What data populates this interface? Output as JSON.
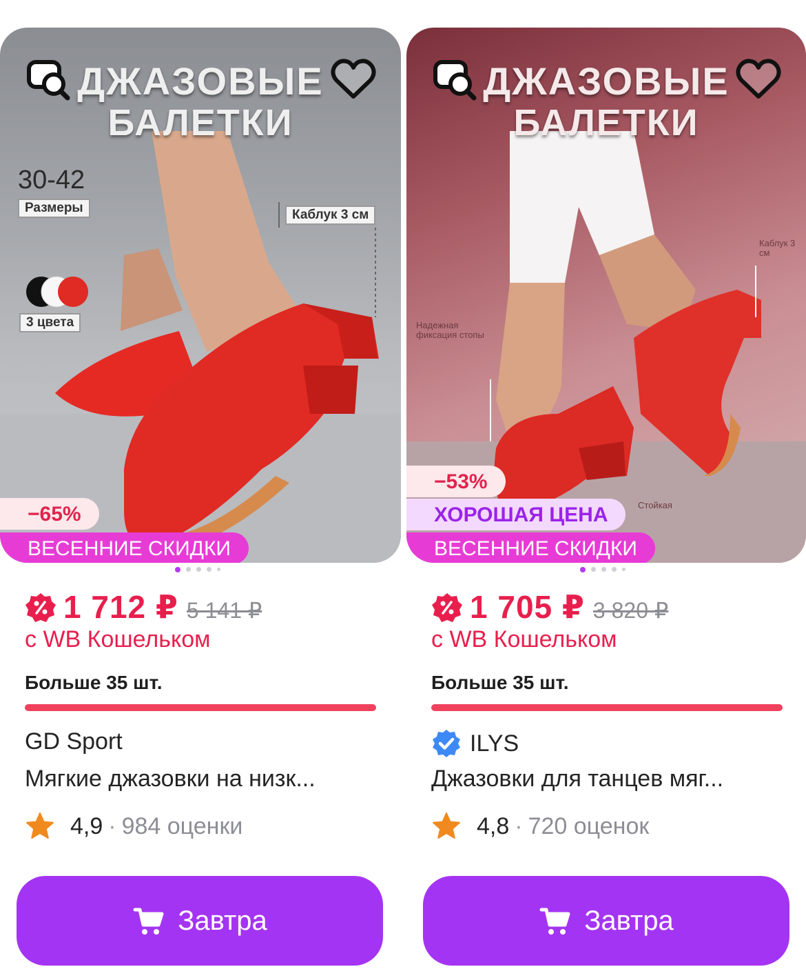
{
  "cards": [
    {
      "photo_title": [
        "ДЖАЗОВЫЕ",
        "БАЛЕТКИ"
      ],
      "photo_specs": {
        "sizes": "30-42",
        "sizes_label": "Размеры",
        "heel": "Каблук 3 см",
        "colors_label": "3 цвета"
      },
      "discount": "−65%",
      "badge_good": "",
      "sale_label": "ВЕСЕННИЕ СКИДКИ",
      "price": "1 712 ₽",
      "old_price": "5 141 ₽",
      "wallet": "с WB Кошельком",
      "stock": "Больше 35 шт.",
      "brand": "GD Sport",
      "verified": false,
      "description": "Мягкие джазовки на низк...",
      "rating": "4,9",
      "separator": "·",
      "reviews": "984 оценки",
      "button": "Завтра",
      "dots_active": 0
    },
    {
      "photo_title": [
        "ДЖАЗОВЫЕ",
        "БАЛЕТКИ"
      ],
      "photo_specs": {
        "heel_note": "Каблук 3 см",
        "fix_note": "Надежная фиксация стопы",
        "sole_note": "Стойкая"
      },
      "discount": "−53%",
      "badge_good": "ХОРОШАЯ ЦЕНА",
      "sale_label": "ВЕСЕННИЕ СКИДКИ",
      "price": "1 705 ₽",
      "old_price": "3 820 ₽",
      "wallet": "с WB Кошельком",
      "stock": "Больше 35 шт.",
      "brand": "ILYS",
      "verified": true,
      "description": "Джазовки для танцев мяг...",
      "rating": "4,8",
      "separator": "·",
      "reviews": "720 оценок",
      "button": "Завтра",
      "dots_active": 0
    }
  ],
  "colors": {
    "price": "#e81f4d",
    "button": "#a434f3",
    "sale_badge": "#e73bd6",
    "stock_bar": "#f0415d",
    "star": "#f08a1e",
    "verified": "#3d8af7"
  },
  "icons": [
    "image-search-icon",
    "heart-icon",
    "wb-wallet-icon",
    "verified-icon",
    "star-icon",
    "cart-icon"
  ]
}
